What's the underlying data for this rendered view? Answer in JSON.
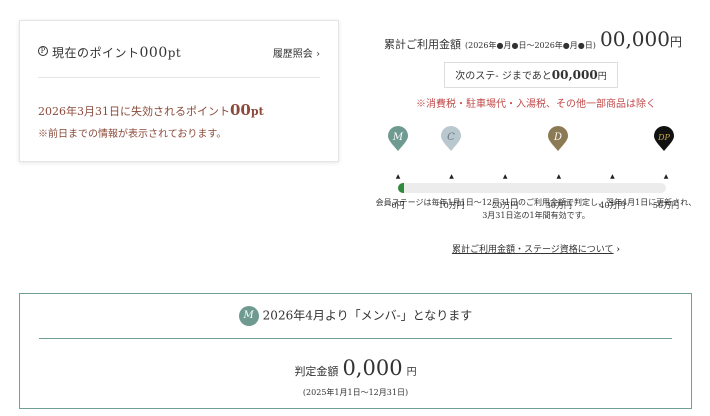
{
  "points_card": {
    "label_prefix": "現在のポイント",
    "points_value": "000",
    "points_unit": "pt",
    "history_link": "履歴照会",
    "expire_text": "2026年3月31日に失効されるポイント",
    "expire_value": "00",
    "expire_unit": "pt",
    "note": "※前日までの情報が表示されております。"
  },
  "usage": {
    "total_label": "累計ご利用金額",
    "total_period": "(2026年●月●日〜2026年●月●日)",
    "total_amount": "00,000",
    "total_unit": "円",
    "next_stage_prefix": "次のステ- ジまであと",
    "next_stage_amount": "00,000",
    "next_stage_unit": "円",
    "tax_note": "※消費税・駐車場代・入湯税、その他一部商品は除く"
  },
  "stages": [
    {
      "code": "M",
      "color": "#6f9a91",
      "text_color": "#ffffff"
    },
    {
      "code": "C",
      "color": "#b9c7cf",
      "text_color": "#6b7b86"
    },
    {
      "code": "D",
      "color": "#8c7a55",
      "text_color": "#ffffff"
    },
    {
      "code": "DP",
      "color": "#111111",
      "text_color": "#c9a64a"
    }
  ],
  "progress": {
    "fraction": 0.02,
    "fill_color": "#2e8b3e",
    "ticks": [
      "0円",
      "10万円",
      "20万円",
      "30万円",
      "40万円",
      "50万円"
    ]
  },
  "stage_note_line1": "会員ステージは毎年1月1日〜12月31日のご利用金額で判定し、翌年4月1日に更新され、",
  "stage_note_line2": "3月31日迄の1年間有効です。",
  "about_link": "累計ご利用金額・ステージ資格について",
  "membership": {
    "badge": "M",
    "text": "2026年4月より「メンバ-」となります",
    "judge_label": "判定金額",
    "judge_amount": "0,000",
    "judge_unit": "円",
    "judge_period": "(2025年1月1日〜12月31日)"
  }
}
